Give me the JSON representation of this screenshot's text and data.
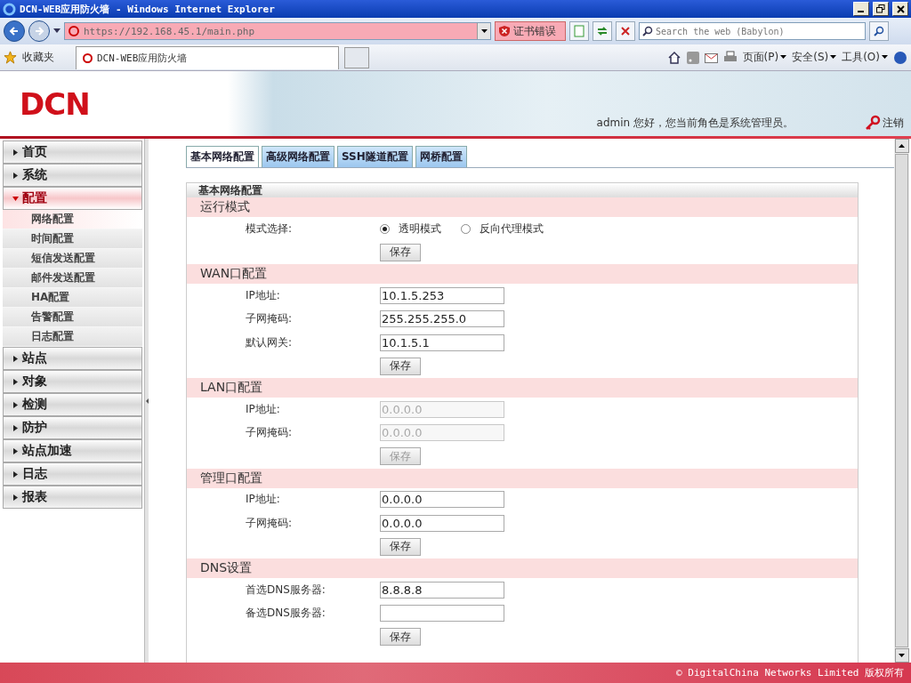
{
  "window": {
    "title": "DCN-WEB应用防火墙 - Windows Internet Explorer"
  },
  "address_bar": {
    "url": "https://192.168.45.1/main.php",
    "cert_error": "证书错误"
  },
  "search": {
    "placeholder": "Search the web (Babylon)"
  },
  "favorites": {
    "label": "收藏夹"
  },
  "browser_tab": {
    "title": "DCN-WEB应用防火墙"
  },
  "command_bar": [
    "页面(P)",
    "安全(S)",
    "工具(O)"
  ],
  "header": {
    "logo": "DCN",
    "greeting": "admin 您好，您当前角色是系统管理员。",
    "logout": "注销"
  },
  "sidebar": {
    "items": [
      {
        "label": "首页",
        "expanded": false
      },
      {
        "label": "系统",
        "expanded": false
      },
      {
        "label": "配置",
        "expanded": true,
        "children": [
          {
            "label": "网络配置",
            "selected": true
          },
          {
            "label": "时间配置",
            "selected": false
          },
          {
            "label": "短信发送配置",
            "selected": false
          },
          {
            "label": "邮件发送配置",
            "selected": false
          },
          {
            "label": "HA配置",
            "selected": false
          },
          {
            "label": "告警配置",
            "selected": false
          },
          {
            "label": "日志配置",
            "selected": false
          }
        ]
      },
      {
        "label": "站点",
        "expanded": false
      },
      {
        "label": "对象",
        "expanded": false
      },
      {
        "label": "检测",
        "expanded": false
      },
      {
        "label": "防护",
        "expanded": false
      },
      {
        "label": "站点加速",
        "expanded": false
      },
      {
        "label": "日志",
        "expanded": false
      },
      {
        "label": "报表",
        "expanded": false
      }
    ]
  },
  "tabs": [
    {
      "label": "基本网络配置",
      "selected": true
    },
    {
      "label": "高级网络配置",
      "selected": false
    },
    {
      "label": "SSH隧道配置",
      "selected": false
    },
    {
      "label": "网桥配置",
      "selected": false
    }
  ],
  "panel": {
    "title": "基本网络配置",
    "sections": [
      {
        "title": "运行模式",
        "rows": [
          {
            "kind": "radio",
            "label": "模式选择:",
            "options": [
              {
                "label": "透明模式",
                "selected": true
              },
              {
                "label": "反向代理模式",
                "selected": false
              }
            ]
          },
          {
            "kind": "button",
            "label": "保存",
            "disabled": false
          }
        ]
      },
      {
        "title": "WAN口配置",
        "rows": [
          {
            "kind": "field",
            "label": "IP地址:",
            "value": "10.1.5.253",
            "disabled": false
          },
          {
            "kind": "field",
            "label": "子网掩码:",
            "value": "255.255.255.0",
            "disabled": false
          },
          {
            "kind": "field",
            "label": "默认网关:",
            "value": "10.1.5.1",
            "disabled": false
          },
          {
            "kind": "button",
            "label": "保存",
            "disabled": false
          }
        ]
      },
      {
        "title": "LAN口配置",
        "rows": [
          {
            "kind": "field",
            "label": "IP地址:",
            "value": "0.0.0.0",
            "disabled": true
          },
          {
            "kind": "field",
            "label": "子网掩码:",
            "value": "0.0.0.0",
            "disabled": true
          },
          {
            "kind": "button",
            "label": "保存",
            "disabled": true
          }
        ]
      },
      {
        "title": "管理口配置",
        "rows": [
          {
            "kind": "field",
            "label": "IP地址:",
            "value": "0.0.0.0",
            "disabled": false
          },
          {
            "kind": "field",
            "label": "子网掩码:",
            "value": "0.0.0.0",
            "disabled": false
          },
          {
            "kind": "button",
            "label": "保存",
            "disabled": false
          }
        ]
      },
      {
        "title": "DNS设置",
        "rows": [
          {
            "kind": "field",
            "label": "首选DNS服务器:",
            "value": "8.8.8.8",
            "disabled": false
          },
          {
            "kind": "field",
            "label": "备选DNS服务器:",
            "disabled": false
          },
          {
            "kind": "button",
            "label": "保存",
            "disabled": false
          }
        ]
      }
    ]
  },
  "footer": {
    "copyright": "© DigitalChina Networks Limited 版权所有"
  }
}
